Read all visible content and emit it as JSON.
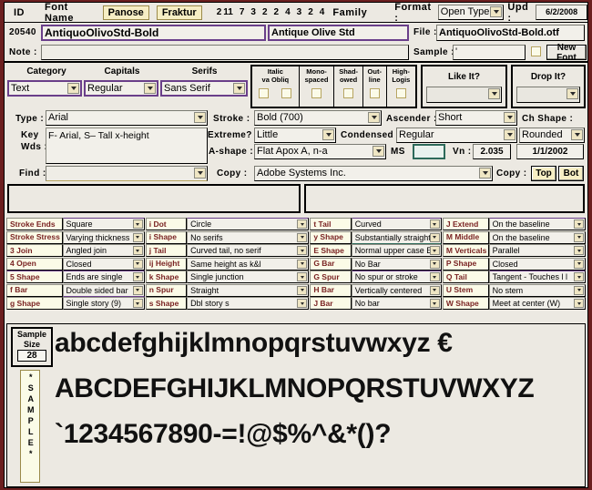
{
  "header": {
    "id_label": "ID",
    "font_name_label": "Font Name",
    "panose_btn": "Panose",
    "fraktur_btn": "Fraktur",
    "panose_digits": [
      "2",
      "11",
      "7",
      "3",
      "2",
      "2",
      "4",
      "3",
      "2",
      "4"
    ],
    "family_label": "Family",
    "format_label": "Format :",
    "format_value": "Open Type",
    "upd_label": "Upd :",
    "upd_value": "6/2/2008"
  },
  "record": {
    "id_value": "20540",
    "font_name_value": "AntiquoOlivoStd-Bold",
    "family_value": "Antique Olive Std",
    "file_label": "File :",
    "file_value": "AntiquoOlivoStd-Bold.otf",
    "note_label": "Note :",
    "note_value": "",
    "sample_label": "Sample :",
    "sample_value": "'",
    "new_font_btn": "New Font"
  },
  "panose": {
    "category_label": "Category",
    "category_value": "Text",
    "capitals_label": "Capitals",
    "capitals_value": "Regular",
    "serifs_label": "Serifs",
    "serifs_value": "Sans Serif",
    "checkboxes": [
      {
        "line1": "Italic",
        "line2": "va Obliq",
        "double": true
      },
      {
        "line1": "Mono-",
        "line2": "spaced",
        "double": false
      },
      {
        "line1": "Shad-",
        "line2": "owed",
        "double": false
      },
      {
        "line1": "Out-",
        "line2": "line",
        "double": false
      },
      {
        "line1": "High-",
        "line2": "Logis",
        "double": false
      }
    ],
    "like_it_label": "Like It?",
    "like_it_value": "",
    "drop_it_label": "Drop It?",
    "drop_it_value": "",
    "type_label": "Type :",
    "type_value": "Arial",
    "stroke_label": "Stroke :",
    "stroke_value": "Bold (700)",
    "ascender_label": "Ascender :",
    "ascender_value": "Short",
    "ch_shape_label": "Ch Shape :",
    "ch_shape_value": "Rounded",
    "key_wds_label": "Key\nWds :",
    "key_wds_line1": "Key",
    "key_wds_line2": "Wds :",
    "key_wds_value": "F- Arial, S– Tall x-height",
    "extreme_label": "Extreme?",
    "extreme_value": "Little",
    "condensed_label": "Condensed :",
    "condensed_value": "Regular",
    "a_shape_label": "A-shape :",
    "a_shape_value": "Flat Apox A, n-a",
    "ms_label": "MS",
    "ms_value": "",
    "vn_label": "Vn :",
    "vn_value": "2.035",
    "vn_date": "1/1/2002",
    "find_label": "Find :",
    "find_value": "",
    "copy_label": "Copy :",
    "copy_value": "Adobe Systems Inc.",
    "copy2_label": "Copy :",
    "copy_top_btn": "Top",
    "copy_bot_btn": "Bot"
  },
  "attributes": [
    {
      "l1": "Stroke Ends",
      "v1": "Square",
      "l2": "i Dot",
      "v2": "Circle",
      "l3": "t Tail",
      "v3": "Curved",
      "l4": "J Extend",
      "v4": "On the baseline"
    },
    {
      "l1": "Stroke Stress",
      "v1": "Varying thickness",
      "l2": "i Shape",
      "v2": "No serifs",
      "l3": "y Shape",
      "v3": "Substantially straight",
      "l4": "M Middle",
      "v4": "On the baseline"
    },
    {
      "l1": "3 Join",
      "v1": "Angled join",
      "l2": "j Tail",
      "v2": "Curved tail, no serif",
      "l3": "E Shape",
      "v3": "Normal upper case E",
      "l4": "M Verticals",
      "v4": "Parallel"
    },
    {
      "l1": "4 Open",
      "v1": "Closed",
      "l2": "ij Height",
      "v2": "Same height as k&l",
      "l3": "G Bar",
      "v3": "No Bar",
      "l4": "P Shape",
      "v4": "Closed"
    },
    {
      "l1": "5 Shape",
      "v1": "Ends are single",
      "l2": "k Shape",
      "v2": "Single junction",
      "l3": "G Spur",
      "v3": "No spur or stroke",
      "l4": "Q Tail",
      "v4": "Tangent - Touches l l"
    },
    {
      "l1": "f Bar",
      "v1": "Double sided bar",
      "l2": "n Spur",
      "v2": "Straight",
      "l3": "H Bar",
      "v3": "Vertically centered",
      "l4": "U Stem",
      "v4": "No stem"
    },
    {
      "l1": "g Shape",
      "v1": "Single story (9)",
      "l2": "s Shape",
      "v2": "Dbl story s",
      "l3": "J Bar",
      "v3": "No bar",
      "l4": "W Shape",
      "v4": "Meet at center (W)"
    }
  ],
  "sample": {
    "size_line1": "Sample",
    "size_line2": "Size",
    "size_value": "28",
    "vertical_label": "*SAMPLE*",
    "line1": "abcdefghijklmnopqrstuvwxyz €",
    "line2": "ABCDEFGHIJKLMNOPQRSTUVWXYZ",
    "line3": "`1234567890-=!@$%^&*()?"
  },
  "colors": {
    "window_border": "#6b1f1f",
    "panel_bg": "#ece9e2",
    "field_bg": "#f2f0ea",
    "label_tan": "#fbfbe7",
    "label_text": "#7a2323",
    "accent_purple": "#6a3f8a",
    "button_tan": "#f6eec4"
  }
}
